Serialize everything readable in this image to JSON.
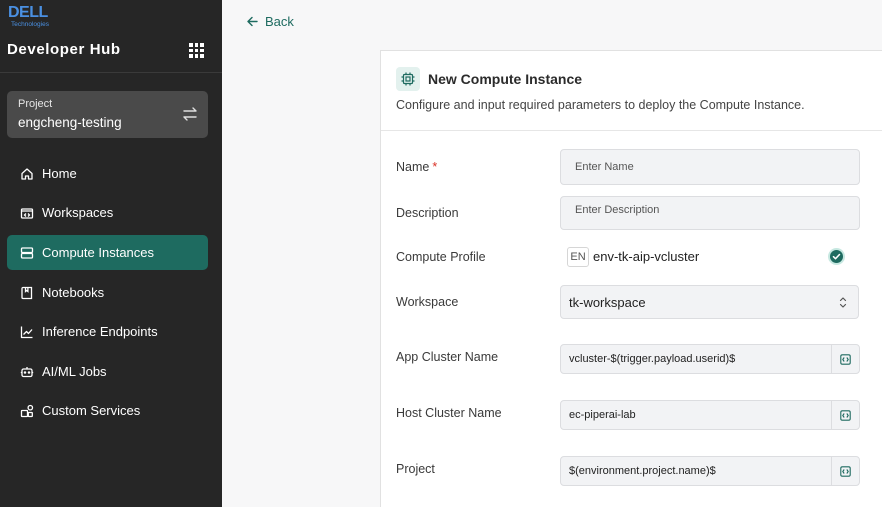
{
  "brand": {
    "name": "DELL",
    "sub": "Technologies"
  },
  "app_title": "Developer Hub",
  "project_card": {
    "label": "Project",
    "value": "engcheng-testing"
  },
  "nav": [
    {
      "label": "Home",
      "icon": "home-icon"
    },
    {
      "label": "Workspaces",
      "icon": "workspace-icon"
    },
    {
      "label": "Compute Instances",
      "icon": "server-icon",
      "active": true
    },
    {
      "label": "Notebooks",
      "icon": "notebook-icon"
    },
    {
      "label": "Inference Endpoints",
      "icon": "chart-line-icon"
    },
    {
      "label": "AI/ML Jobs",
      "icon": "bot-icon"
    },
    {
      "label": "Custom Services",
      "icon": "shapes-icon"
    }
  ],
  "back_label": "Back",
  "panel": {
    "title": "New Compute Instance",
    "description": "Configure and input required parameters to deploy the Compute Instance."
  },
  "form": {
    "name": {
      "label": "Name",
      "required_mark": "*",
      "placeholder": "Enter Name"
    },
    "description": {
      "label": "Description",
      "placeholder": "Enter Description"
    },
    "compute_profile": {
      "label": "Compute Profile",
      "badge": "EN",
      "value": "env-tk-aip-vcluster"
    },
    "workspace": {
      "label": "Workspace",
      "value": "tk-workspace"
    },
    "app_cluster": {
      "label": "App Cluster Name",
      "value": "vcluster-$(trigger.payload.userid)$"
    },
    "host_cluster": {
      "label": "Host Cluster Name",
      "value": "ec-piperai-lab"
    },
    "project": {
      "label": "Project",
      "value": "$(environment.project.name)$"
    }
  },
  "colors": {
    "accent": "#1e6b60",
    "sidebar_bg": "#262626",
    "brand_blue": "#4a90e2"
  }
}
